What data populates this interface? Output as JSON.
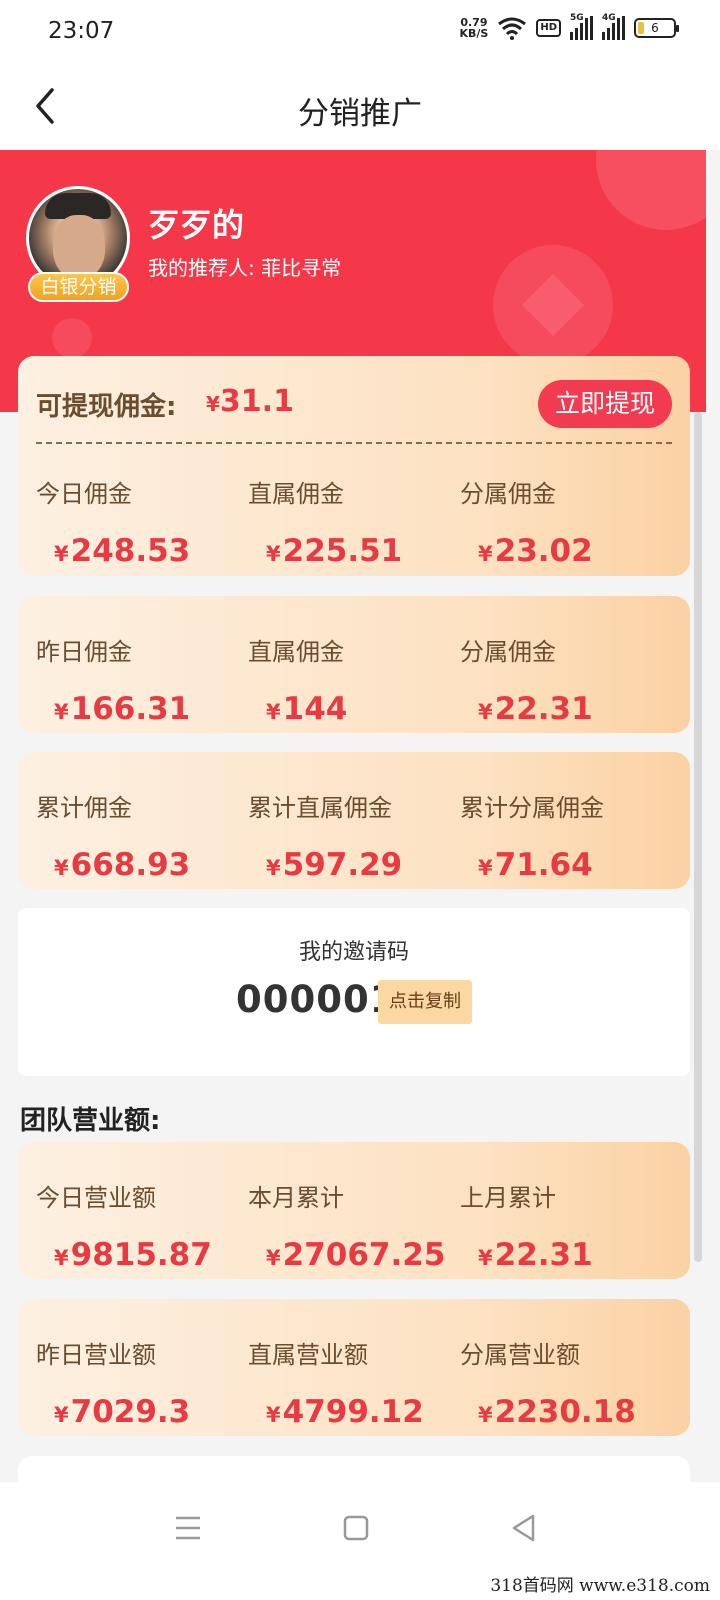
{
  "status_bar": {
    "time": "23:07",
    "net_speed_value": "0.79",
    "net_speed_unit": "KB/S",
    "hd_label": "HD",
    "sim1_label": "5G",
    "sim2_label": "4G",
    "battery_level": "6"
  },
  "nav": {
    "title": "分销推广",
    "back_icon": "chevron-left-icon"
  },
  "profile": {
    "name": "歹歹的",
    "level_badge": "白银分销",
    "referrer_label": "我的推荐人:",
    "referrer_name": "菲比寻常"
  },
  "withdraw": {
    "label": "可提现佣金:",
    "currency": "¥",
    "amount": "31.1",
    "button": "立即提现"
  },
  "commission_rows": [
    {
      "cells": [
        {
          "label": "今日佣金",
          "currency": "¥",
          "value": "248.53"
        },
        {
          "label": "直属佣金",
          "currency": "¥",
          "value": "225.51"
        },
        {
          "label": "分属佣金",
          "currency": "¥",
          "value": "23.02"
        }
      ]
    },
    {
      "cells": [
        {
          "label": "昨日佣金",
          "currency": "¥",
          "value": "166.31"
        },
        {
          "label": "直属佣金",
          "currency": "¥",
          "value": "144"
        },
        {
          "label": "分属佣金",
          "currency": "¥",
          "value": "22.31"
        }
      ]
    },
    {
      "cells": [
        {
          "label": "累计佣金",
          "currency": "¥",
          "value": "668.93"
        },
        {
          "label": "累计直属佣金",
          "currency": "¥",
          "value": "597.29"
        },
        {
          "label": "累计分属佣金",
          "currency": "¥",
          "value": "71.64"
        }
      ]
    }
  ],
  "invite": {
    "label": "我的邀请码",
    "code": "000001",
    "copy_button": "点击复制"
  },
  "team": {
    "title": "团队营业额:",
    "rows": [
      {
        "cells": [
          {
            "label": "今日营业额",
            "currency": "¥",
            "value": "9815.87"
          },
          {
            "label": "本月累计",
            "currency": "¥",
            "value": "27067.25"
          },
          {
            "label": "上月累计",
            "currency": "¥",
            "value": "22.31"
          }
        ]
      },
      {
        "cells": [
          {
            "label": "昨日营业额",
            "currency": "¥",
            "value": "7029.3"
          },
          {
            "label": "直属营业额",
            "currency": "¥",
            "value": "4799.12"
          },
          {
            "label": "分属营业额",
            "currency": "¥",
            "value": "2230.18"
          }
        ]
      }
    ]
  },
  "system_nav": {
    "menu_icon": "menu-icon",
    "home_icon": "square-icon",
    "back_icon": "triangle-back-icon"
  },
  "watermark": "318首码网  www.e318.com",
  "colors": {
    "brand_red": "#f5374a",
    "value_red": "#e73a42",
    "card_start": "#fdf0e2",
    "card_end": "#fbd1a3",
    "badge": "#f0a21f"
  }
}
